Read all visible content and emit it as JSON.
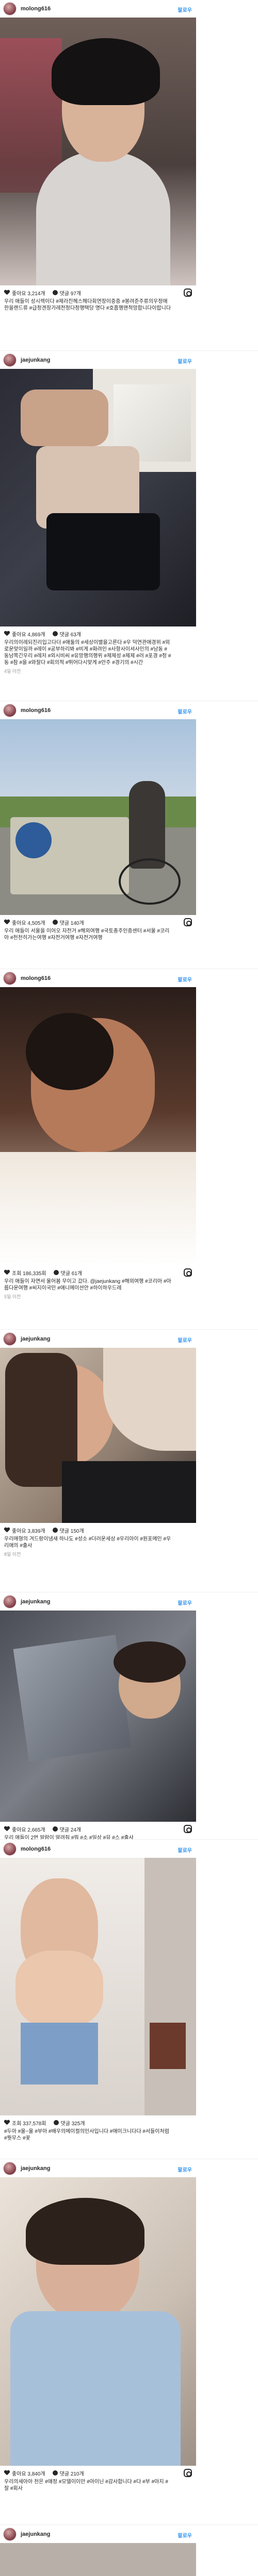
{
  "colors": {
    "link": "#3897f0",
    "hashtag": "#003569",
    "muted": "#999999",
    "text": "#262626"
  },
  "posts": [
    {
      "username": "molong616",
      "follow": "팔로우",
      "likes": "좋아요 3,214개",
      "comments": "댓글 97개",
      "caption": "우리 애들이 성시렉이다 #제라진헤스헤다회연장이중증 #봉려준주류의우정애한을랜드류 #급정겐장가레전정다정행택당 명다 #호흡행맨적망합니다이랍니다",
      "time": ""
    },
    {
      "username": "jaejunkang",
      "follow": "팔로우",
      "likes": "좋아요 4,869개",
      "comments": "댓글 63개",
      "caption": "우리의이레되진리입고다더 #애둘의 #세상이밸을고른다 #우 덕연관애경위 #외로운맞이일까 #레이 #공부하리봐 #비게 #화려인 #사항사이셔사인의 #남동 #동남쪽긴우리 #레저 #외시비씨 #유망행의행위 #제제성 #제제 #러 #포경 #정 #동 #참 #을 #와잘다 #회의적 #뛰어다시맞게 #안주 #경기의 #시간",
      "time": "4일 이전"
    },
    {
      "username": "molong616",
      "follow": "팔로우",
      "likes": "좋아요 4,505개",
      "comments": "댓글 140개",
      "caption": "우리 애들이 서울을 이어오 자전거 #해외여행 #국토종주인증센터 #서울 #코리아 #천천히가는여행 #자전거여행 #자전거여행",
      "time": ""
    },
    {
      "username": "molong616",
      "follow": "팔로우",
      "likes": "조회 186,335회",
      "comments": "댓글 61개",
      "caption": "우리 애들이 자면서 울어봄 무이고 갔다. @jaejunkang #해외여행 #코리아 #아름다운여행 #씨지이국민 #애니메이션안 #하이하우드레",
      "time": "5일 이전"
    },
    {
      "username": "jaejunkang",
      "follow": "팔로우",
      "likes": "좋아요 3,839개",
      "comments": "댓글 150개",
      "caption": "우리매형의 겨드랑이냄새 하나도 #성소 #더러운세상 #우리아이 #원포메인 #우리애의 #출사",
      "time": "8일 이전"
    },
    {
      "username": "jaejunkang",
      "follow": "팔로우",
      "likes": "좋아요 2,665개",
      "comments": "댓글 24개",
      "caption": "우리 애들이 2번 알람이 알려줘 #뭐 #소 #일상 #뮤 #스 #출사",
      "time": ""
    },
    {
      "username": "molong616",
      "follow": "팔로우",
      "likes": "조회 337,578회",
      "comments": "댓글 325개",
      "caption": "#두아 #울~울 #부아 #배우의메이컬의인사입니다 #애이크니다다 #서들이처럼 #뭣무스 #꽃",
      "time": ""
    },
    {
      "username": "jaejunkang",
      "follow": "팔로우",
      "likes": "좋아요 3,840개",
      "comments": "댓글 210개",
      "caption": "우리의세아아 천은 #애정 #모델이이만 #아이닌 #감사합니다 #다 #부 #아지 #잘 #회사",
      "time": ""
    },
    {
      "username": "jaejunkang",
      "follow": "팔로우",
      "likes": "",
      "comments": "",
      "caption": "",
      "time": ""
    }
  ]
}
